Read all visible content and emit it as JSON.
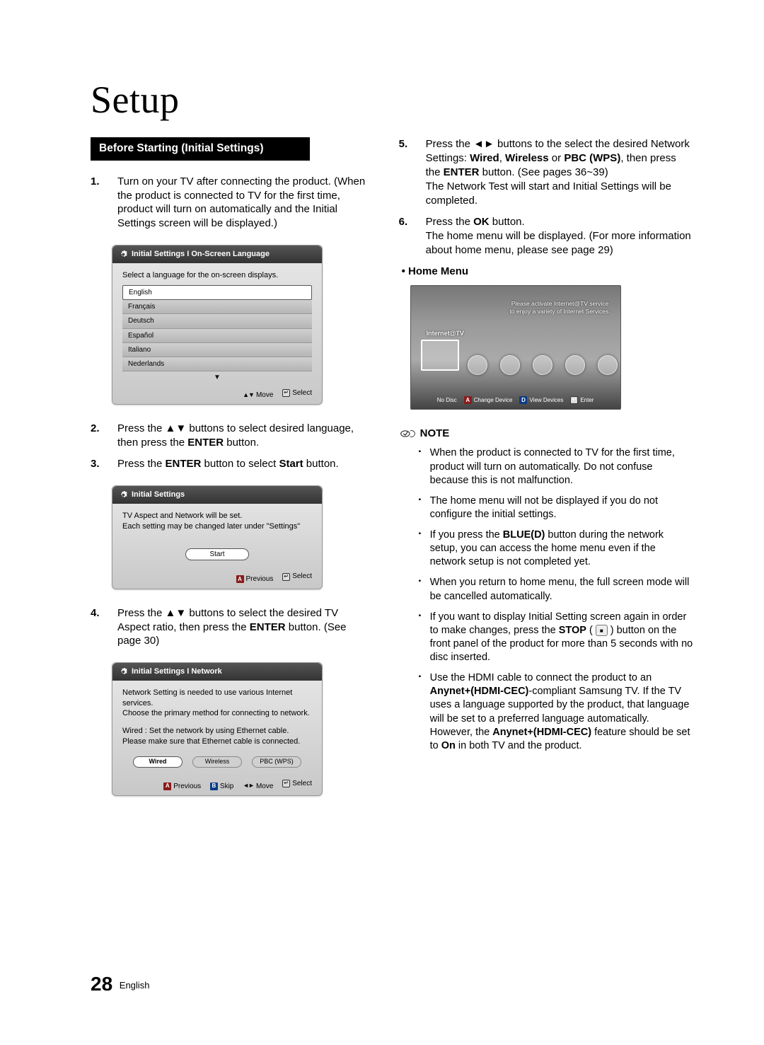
{
  "title": "Setup",
  "sectionBar": "Before Starting (Initial Settings)",
  "steps": {
    "s1": {
      "num": "1.",
      "text": "Turn on your TV after connecting the product. (When the product is connected to TV for the first time, product will turn on automatically and the Initial Settings screen will be displayed.)"
    },
    "s2": {
      "num": "2.",
      "pre": "Press the ",
      "arrows": "▲▼",
      "post": " buttons to select desired language, then press the ",
      "enter": "ENTER",
      "tail": " button."
    },
    "s3": {
      "num": "3.",
      "pre": "Press the ",
      "enter": "ENTER",
      "mid": " button to select ",
      "start": "Start",
      "tail": " button."
    },
    "s4": {
      "num": "4.",
      "pre": "Press the ",
      "arrows": "▲▼",
      "mid": " buttons to select the desired TV Aspect ratio, then press the ",
      "enter": "ENTER",
      "tail": " button. (See page 30)"
    },
    "s5": {
      "num": "5.",
      "pre": "Press the ",
      "arrows": "◄►",
      "mid1": " buttons to the select the desired Network Settings: ",
      "wired": "Wired",
      "c1": ", ",
      "wireless": "Wireless",
      "or": " or ",
      "pbc": "PBC (WPS)",
      "mid2": ", then press the ",
      "enter": "ENTER",
      "mid3": " button. (See pages 36~39)",
      "tail": "The Network Test will start and Initial Settings will be completed."
    },
    "s6": {
      "num": "6.",
      "pre": "Press the ",
      "ok": "OK",
      "mid": " button.",
      "tail": "The home menu will be displayed. (For more information about home menu, please see page 29)"
    }
  },
  "osd1": {
    "title": "Initial Settings I On-Screen Language",
    "prompt": "Select a language for the on-screen displays.",
    "langs": [
      "English",
      "Français",
      "Deutsch",
      "Español",
      "Italiano",
      "Nederlands"
    ],
    "move": "Move",
    "select": "Select"
  },
  "osd2": {
    "title": "Initial Settings",
    "line1": "TV Aspect and Network will be set.",
    "line2": "Each setting may be changed later under \"Settings\"",
    "start": "Start",
    "previous": "Previous",
    "select": "Select",
    "keyA": "A"
  },
  "osd3": {
    "title": "Initial Settings I Network",
    "line1": "Network Setting is needed to use various Internet services.",
    "line2": "Choose the primary method for connecting to network.",
    "line3": "Wired : Set the network by using Ethernet cable.",
    "line4": "Please make sure that Ethernet cable is connected.",
    "btn1": "Wired",
    "btn2": "Wireless",
    "btn3": "PBC (WPS)",
    "previous": "Previous",
    "skip": "Skip",
    "move": "Move",
    "select": "Select",
    "keyA": "A",
    "keyB": "B"
  },
  "homeHdr": "Home Menu",
  "home": {
    "banner1": "Please activate Internet@TV service",
    "banner2": "to enjoy a variety of Internet Services.",
    "label": "Internet@TV",
    "nodisc": "No Disc",
    "change": "Change Device",
    "view": "View Devices",
    "enter": "Enter",
    "keyA": "A",
    "keyD": "D"
  },
  "noteLabel": "NOTE",
  "notes": {
    "n1": "When the product is connected to TV for the first time, product will turn on automatically. Do not confuse because this is not malfunction.",
    "n2": "The home menu will not be displayed if you do not configure the initial settings.",
    "n3a": "If you press the ",
    "n3blue": "BLUE(D)",
    "n3b": " button during the network setup, you can access the home menu even if the network setup is not completed yet.",
    "n4": "When you return to home menu, the full screen mode will be cancelled automatically.",
    "n5a": "If you want to display Initial Setting screen again in order to make changes, press the ",
    "n5stop": "STOP",
    "n5b": " button on the front panel of the product for more than 5 seconds with no disc inserted.",
    "n6a": "Use the HDMI cable to connect the product to an ",
    "n6anynet": "Anynet+(HDMI-CEC)",
    "n6b": "-compliant Samsung TV. If the TV uses a language supported by the product, that language will be set to a preferred language automatically.",
    "n6c": "However, the ",
    "n6anynet2": "Anynet+(HDMI-CEC)",
    "n6d": " feature should be set to ",
    "n6on": "On",
    "n6e": " in both TV and the product."
  },
  "footer": {
    "page": "28",
    "lang": "English"
  }
}
